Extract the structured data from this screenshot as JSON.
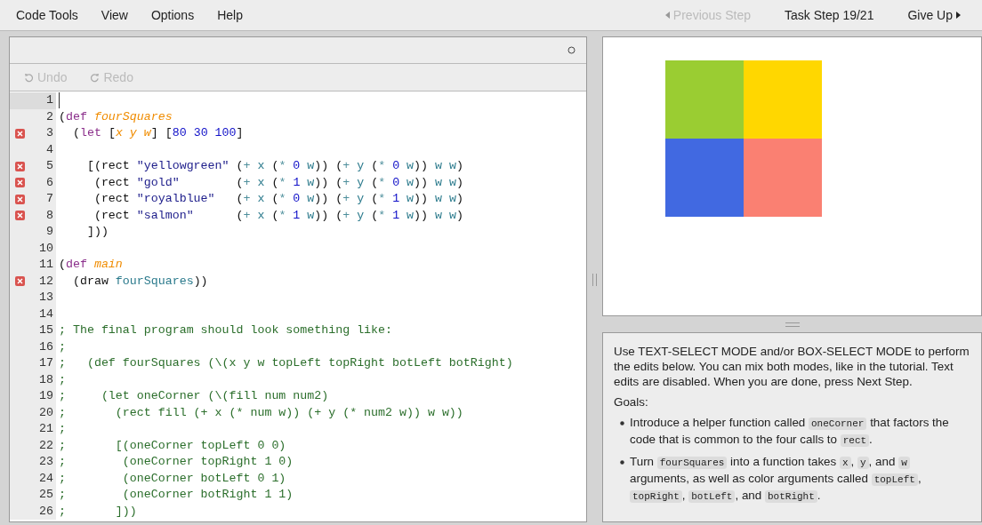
{
  "menu": {
    "items": [
      "Code Tools",
      "View",
      "Options",
      "Help"
    ],
    "previous": {
      "label": "Previous Step",
      "disabled": true
    },
    "step": "Task Step 19/21",
    "give_up": {
      "label": "Give Up",
      "disabled": false
    }
  },
  "toolbar": {
    "undo": {
      "label": "Undo",
      "disabled": true
    },
    "redo": {
      "label": "Redo",
      "disabled": true
    }
  },
  "code": [
    {
      "number": "1",
      "error": false,
      "active": true
    },
    {
      "number": "2",
      "error": false,
      "active": false,
      "tokens": [
        {
          "kind": "punct",
          "text": "("
        },
        {
          "kind": "keyword",
          "text": "def "
        },
        {
          "kind": "binding",
          "text": "fourSquares"
        }
      ]
    },
    {
      "number": "3",
      "error": true,
      "active": false,
      "tokens": [
        {
          "kind": "punct",
          "text": "  ("
        },
        {
          "kind": "keyword",
          "text": "let"
        },
        {
          "kind": "punct",
          "text": " ["
        },
        {
          "kind": "binding",
          "text": "x y w"
        },
        {
          "kind": "punct",
          "text": "] ["
        },
        {
          "kind": "number",
          "text": "80 30 100"
        },
        {
          "kind": "punct",
          "text": "]"
        }
      ]
    },
    {
      "number": "4",
      "error": false,
      "active": false
    },
    {
      "number": "5",
      "error": true,
      "active": false,
      "tokens": [
        {
          "kind": "punct",
          "text": "    [(rect "
        },
        {
          "kind": "string",
          "text": "\"yellowgreen\""
        },
        {
          "kind": "punct",
          "text": " ("
        },
        {
          "kind": "op",
          "text": "+"
        },
        {
          "kind": "ident",
          "text": " x"
        },
        {
          "kind": "punct",
          "text": " ("
        },
        {
          "kind": "op",
          "text": "*"
        },
        {
          "kind": "number",
          "text": " 0"
        },
        {
          "kind": "ident",
          "text": " w"
        },
        {
          "kind": "punct",
          "text": ")) ("
        },
        {
          "kind": "op",
          "text": "+"
        },
        {
          "kind": "ident",
          "text": " y"
        },
        {
          "kind": "punct",
          "text": " ("
        },
        {
          "kind": "op",
          "text": "*"
        },
        {
          "kind": "number",
          "text": " 0"
        },
        {
          "kind": "ident",
          "text": " w"
        },
        {
          "kind": "punct",
          "text": ")) "
        },
        {
          "kind": "ident",
          "text": "w w"
        },
        {
          "kind": "punct",
          "text": ")"
        }
      ]
    },
    {
      "number": "6",
      "error": true,
      "active": false,
      "tokens": [
        {
          "kind": "punct",
          "text": "     (rect "
        },
        {
          "kind": "string",
          "text": "\"gold\""
        },
        {
          "kind": "punct",
          "text": "        ("
        },
        {
          "kind": "op",
          "text": "+"
        },
        {
          "kind": "ident",
          "text": " x"
        },
        {
          "kind": "punct",
          "text": " ("
        },
        {
          "kind": "op",
          "text": "*"
        },
        {
          "kind": "number",
          "text": " 1"
        },
        {
          "kind": "ident",
          "text": " w"
        },
        {
          "kind": "punct",
          "text": ")) ("
        },
        {
          "kind": "op",
          "text": "+"
        },
        {
          "kind": "ident",
          "text": " y"
        },
        {
          "kind": "punct",
          "text": " ("
        },
        {
          "kind": "op",
          "text": "*"
        },
        {
          "kind": "number",
          "text": " 0"
        },
        {
          "kind": "ident",
          "text": " w"
        },
        {
          "kind": "punct",
          "text": ")) "
        },
        {
          "kind": "ident",
          "text": "w w"
        },
        {
          "kind": "punct",
          "text": ")"
        }
      ]
    },
    {
      "number": "7",
      "error": true,
      "active": false,
      "tokens": [
        {
          "kind": "punct",
          "text": "     (rect "
        },
        {
          "kind": "string",
          "text": "\"royalblue\""
        },
        {
          "kind": "punct",
          "text": "   ("
        },
        {
          "kind": "op",
          "text": "+"
        },
        {
          "kind": "ident",
          "text": " x"
        },
        {
          "kind": "punct",
          "text": " ("
        },
        {
          "kind": "op",
          "text": "*"
        },
        {
          "kind": "number",
          "text": " 0"
        },
        {
          "kind": "ident",
          "text": " w"
        },
        {
          "kind": "punct",
          "text": ")) ("
        },
        {
          "kind": "op",
          "text": "+"
        },
        {
          "kind": "ident",
          "text": " y"
        },
        {
          "kind": "punct",
          "text": " ("
        },
        {
          "kind": "op",
          "text": "*"
        },
        {
          "kind": "number",
          "text": " 1"
        },
        {
          "kind": "ident",
          "text": " w"
        },
        {
          "kind": "punct",
          "text": ")) "
        },
        {
          "kind": "ident",
          "text": "w w"
        },
        {
          "kind": "punct",
          "text": ")"
        }
      ]
    },
    {
      "number": "8",
      "error": true,
      "active": false,
      "tokens": [
        {
          "kind": "punct",
          "text": "     (rect "
        },
        {
          "kind": "string",
          "text": "\"salmon\""
        },
        {
          "kind": "punct",
          "text": "      ("
        },
        {
          "kind": "op",
          "text": "+"
        },
        {
          "kind": "ident",
          "text": " x"
        },
        {
          "kind": "punct",
          "text": " ("
        },
        {
          "kind": "op",
          "text": "*"
        },
        {
          "kind": "number",
          "text": " 1"
        },
        {
          "kind": "ident",
          "text": " w"
        },
        {
          "kind": "punct",
          "text": ")) ("
        },
        {
          "kind": "op",
          "text": "+"
        },
        {
          "kind": "ident",
          "text": " y"
        },
        {
          "kind": "punct",
          "text": " ("
        },
        {
          "kind": "op",
          "text": "*"
        },
        {
          "kind": "number",
          "text": " 1"
        },
        {
          "kind": "ident",
          "text": " w"
        },
        {
          "kind": "punct",
          "text": ")) "
        },
        {
          "kind": "ident",
          "text": "w w"
        },
        {
          "kind": "punct",
          "text": ")"
        }
      ]
    },
    {
      "number": "9",
      "error": false,
      "active": false,
      "tokens": [
        {
          "kind": "punct",
          "text": "    ]))"
        }
      ]
    },
    {
      "number": "10",
      "error": false,
      "active": false
    },
    {
      "number": "11",
      "error": false,
      "active": false,
      "tokens": [
        {
          "kind": "punct",
          "text": "("
        },
        {
          "kind": "keyword",
          "text": "def "
        },
        {
          "kind": "binding",
          "text": "main"
        }
      ]
    },
    {
      "number": "12",
      "error": true,
      "active": false,
      "tokens": [
        {
          "kind": "punct",
          "text": "  (draw "
        },
        {
          "kind": "ident",
          "text": "fourSquares"
        },
        {
          "kind": "punct",
          "text": "))"
        }
      ]
    },
    {
      "number": "13",
      "error": false,
      "active": false
    },
    {
      "number": "14",
      "error": false,
      "active": false
    },
    {
      "number": "15",
      "error": false,
      "active": false,
      "tokens": [
        {
          "kind": "comment",
          "text": "; The final program should look something like:"
        }
      ]
    },
    {
      "number": "16",
      "error": false,
      "active": false,
      "tokens": [
        {
          "kind": "comment",
          "text": ";"
        }
      ]
    },
    {
      "number": "17",
      "error": false,
      "active": false,
      "tokens": [
        {
          "kind": "comment",
          "text": ";   (def fourSquares (\\(x y w topLeft topRight botLeft botRight)"
        }
      ]
    },
    {
      "number": "18",
      "error": false,
      "active": false,
      "tokens": [
        {
          "kind": "comment",
          "text": ";"
        }
      ]
    },
    {
      "number": "19",
      "error": false,
      "active": false,
      "tokens": [
        {
          "kind": "comment",
          "text": ";     (let oneCorner (\\(fill num num2)"
        }
      ]
    },
    {
      "number": "20",
      "error": false,
      "active": false,
      "tokens": [
        {
          "kind": "comment",
          "text": ";       (rect fill (+ x (* num w)) (+ y (* num2 w)) w w))"
        }
      ]
    },
    {
      "number": "21",
      "error": false,
      "active": false,
      "tokens": [
        {
          "kind": "comment",
          "text": ";"
        }
      ]
    },
    {
      "number": "22",
      "error": false,
      "active": false,
      "tokens": [
        {
          "kind": "comment",
          "text": ";       [(oneCorner topLeft 0 0)"
        }
      ]
    },
    {
      "number": "23",
      "error": false,
      "active": false,
      "tokens": [
        {
          "kind": "comment",
          "text": ";        (oneCorner topRight 1 0)"
        }
      ]
    },
    {
      "number": "24",
      "error": false,
      "active": false,
      "tokens": [
        {
          "kind": "comment",
          "text": ";        (oneCorner botLeft 0 1)"
        }
      ]
    },
    {
      "number": "25",
      "error": false,
      "active": false,
      "tokens": [
        {
          "kind": "comment",
          "text": ";        (oneCorner botRight 1 1)"
        }
      ]
    },
    {
      "number": "26",
      "error": false,
      "active": false,
      "tokens": [
        {
          "kind": "comment",
          "text": ";       ]))"
        }
      ]
    }
  ],
  "canvas": {
    "squares": [
      {
        "color": "#9acd32"
      },
      {
        "color": "#ffd700"
      },
      {
        "color": "#4169e1"
      },
      {
        "color": "#fa8072"
      }
    ]
  },
  "task": {
    "instructions": "Use TEXT-SELECT MODE and/or BOX-SELECT MODE to perform the edits below. You can mix both modes, like in the tutorial. Text edits are disabled. When you are done, press Next Step.",
    "goals_heading": "Goals:",
    "goals": [
      [
        {
          "kind": "text",
          "text": "Introduce a helper function called "
        },
        {
          "kind": "code",
          "text": "oneCorner"
        },
        {
          "kind": "text",
          "text": " that factors the code that is common to the four calls to "
        },
        {
          "kind": "code",
          "text": "rect"
        },
        {
          "kind": "text",
          "text": "."
        }
      ],
      [
        {
          "kind": "text",
          "text": "Turn "
        },
        {
          "kind": "code",
          "text": "fourSquares"
        },
        {
          "kind": "text",
          "text": " into a function takes "
        },
        {
          "kind": "code",
          "text": "x"
        },
        {
          "kind": "text",
          "text": ", "
        },
        {
          "kind": "code",
          "text": "y"
        },
        {
          "kind": "text",
          "text": ", and "
        },
        {
          "kind": "code",
          "text": "w"
        },
        {
          "kind": "text",
          "text": " arguments, as well as color arguments called "
        },
        {
          "kind": "code",
          "text": "topLeft"
        },
        {
          "kind": "text",
          "text": ", "
        },
        {
          "kind": "code",
          "text": "topRight"
        },
        {
          "kind": "text",
          "text": ", "
        },
        {
          "kind": "code",
          "text": "botLeft"
        },
        {
          "kind": "text",
          "text": ", and "
        },
        {
          "kind": "code",
          "text": "botRight"
        },
        {
          "kind": "text",
          "text": "."
        }
      ]
    ]
  }
}
